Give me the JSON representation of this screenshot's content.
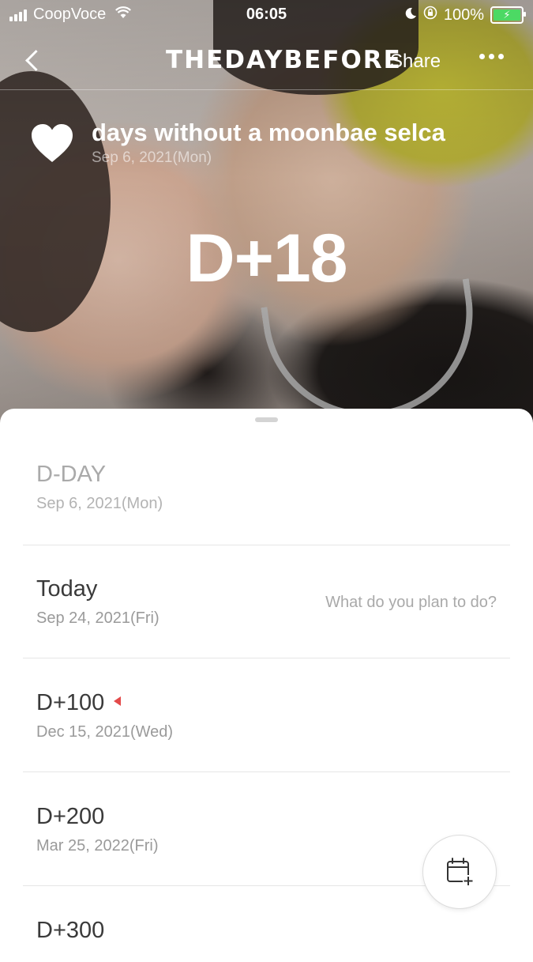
{
  "status_bar": {
    "carrier": "CoopVoce",
    "time": "06:05",
    "battery": "100%",
    "icons": [
      "signal-icon",
      "wifi-icon",
      "moon-icon",
      "orientation-lock-icon",
      "battery-charging-icon"
    ]
  },
  "header": {
    "brand": "THEDAYBEFORE",
    "share_label": "Share",
    "icons": [
      "back-icon",
      "more-icon"
    ]
  },
  "hero": {
    "title": "days without a moonbae selca",
    "start_date": "Sep 6, 2021(Mon)",
    "count": "D+18",
    "icon": "heart-icon"
  },
  "milestones": [
    {
      "label": "D-DAY",
      "date": "Sep 6, 2021(Mon)"
    },
    {
      "label": "Today",
      "date": "Sep 24, 2021(Fri)",
      "plan_placeholder": "What do you plan to do?"
    },
    {
      "label": "D+100",
      "date": "Dec 15, 2021(Wed)"
    },
    {
      "label": "D+200",
      "date": "Mar 25, 2022(Fri)"
    },
    {
      "label": "D+300",
      "date": ""
    }
  ],
  "fab": {
    "icon": "calendar-add-icon"
  },
  "colors": {
    "accent_marker": "#e34a4a",
    "battery_fill": "#4cd964"
  }
}
